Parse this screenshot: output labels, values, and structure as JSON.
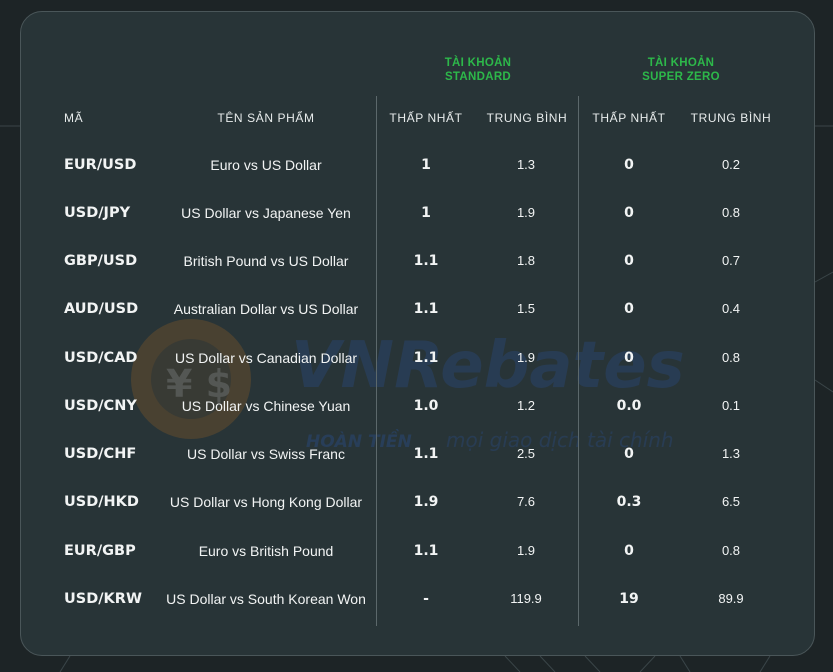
{
  "groups": {
    "standard": {
      "line1": "TÀI KHOẢN",
      "line2": "STANDARD"
    },
    "super_zero": {
      "line1": "TÀI KHOẢN",
      "line2": "SUPER ZERO"
    }
  },
  "columns": {
    "code": "MÃ",
    "name": "TÊN SẢN PHẨM",
    "std_min": "THẤP NHẤT",
    "std_avg": "TRUNG BÌNH",
    "sz_min": "THẤP NHẤT",
    "sz_avg": "TRUNG BÌNH"
  },
  "rows": [
    {
      "code": "EUR/USD",
      "name": "Euro vs US Dollar",
      "std_min": "1",
      "std_avg": "1.3",
      "sz_min": "0",
      "sz_avg": "0.2"
    },
    {
      "code": "USD/JPY",
      "name": "US Dollar vs Japanese Yen",
      "std_min": "1",
      "std_avg": "1.9",
      "sz_min": "0",
      "sz_avg": "0.8"
    },
    {
      "code": "GBP/USD",
      "name": "British Pound vs US Dollar",
      "std_min": "1.1",
      "std_avg": "1.8",
      "sz_min": "0",
      "sz_avg": "0.7"
    },
    {
      "code": "AUD/USD",
      "name": "Australian Dollar vs US Dollar",
      "std_min": "1.1",
      "std_avg": "1.5",
      "sz_min": "0",
      "sz_avg": "0.4"
    },
    {
      "code": "USD/CAD",
      "name": "US Dollar vs Canadian Dollar",
      "std_min": "1.1",
      "std_avg": "1.9",
      "sz_min": "0",
      "sz_avg": "0.8"
    },
    {
      "code": "USD/CNY",
      "name": "US Dollar vs Chinese Yuan",
      "std_min": "1.0",
      "std_avg": "1.2",
      "sz_min": "0.0",
      "sz_avg": "0.1"
    },
    {
      "code": "USD/CHF",
      "name": "US Dollar vs Swiss Franc",
      "std_min": "1.1",
      "std_avg": "2.5",
      "sz_min": "0",
      "sz_avg": "1.3"
    },
    {
      "code": "USD/HKD",
      "name": "US Dollar vs Hong Kong Dollar",
      "std_min": "1.9",
      "std_avg": "7.6",
      "sz_min": "0.3",
      "sz_avg": "6.5"
    },
    {
      "code": "EUR/GBP",
      "name": "Euro vs British Pound",
      "std_min": "1.1",
      "std_avg": "1.9",
      "sz_min": "0",
      "sz_avg": "0.8"
    },
    {
      "code": "USD/KRW",
      "name": "US Dollar vs South Korean Won",
      "std_min": "-",
      "std_avg": "119.9",
      "sz_min": "19",
      "sz_avg": "89.9"
    }
  ],
  "watermark": {
    "brand": "VNRebates",
    "tag": "HOÀN TIỀN",
    "slogan": "mọi giao dịch tài chính"
  },
  "colors": {
    "background": "#1d2426",
    "panel": "#283437",
    "accent_green": "#2db84a",
    "text": "#f2f4f4"
  }
}
